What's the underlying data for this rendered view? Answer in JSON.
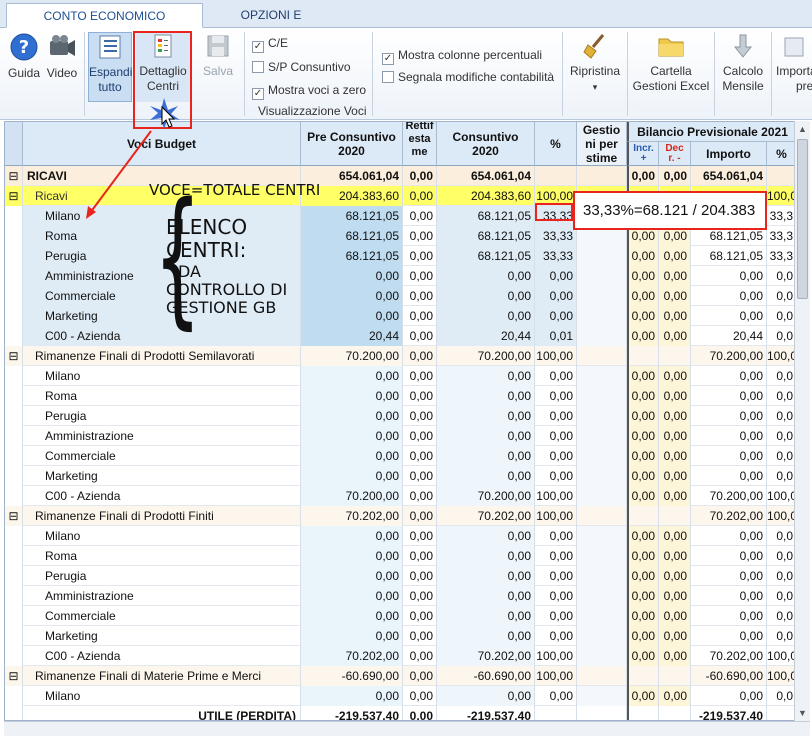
{
  "tabs": [
    {
      "label": "CONTO ECONOMICO ANNUALE",
      "active": true
    },
    {
      "label": "OPZIONI E STAMPA",
      "active": false
    }
  ],
  "ribbon": {
    "buttons": {
      "guida": "Guida",
      "video": "Video",
      "espandi": [
        "Espandi",
        "tutto"
      ],
      "dettaglio": [
        "Dettaglio",
        "Centri"
      ],
      "salva": "Salva",
      "ripristina": "Ripristina",
      "cartella": [
        "Cartella",
        "Gestioni Excel"
      ],
      "calcolo": [
        "Calcolo",
        "Mensile"
      ],
      "importa": [
        "Importa",
        "pre"
      ]
    },
    "checks": [
      {
        "label": "C/E",
        "checked": true
      },
      {
        "label": "S/P Consuntivo",
        "checked": false
      },
      {
        "label": "Mostra voci a zero",
        "checked": true
      },
      {
        "label": "Mostra colonne percentuali",
        "checked": true
      },
      {
        "label": "Segnala modifiche contabilità",
        "checked": false
      }
    ],
    "group_label": "Visualizzazione Voci"
  },
  "grid": {
    "headers": {
      "voci": "Voci Budget",
      "pre": [
        "Pre Consuntivo",
        "2020"
      ],
      "rett": [
        "Rettif",
        "esta",
        "me"
      ],
      "cons": [
        "Consuntivo",
        "2020"
      ],
      "pct": "%",
      "gest": [
        "Gestio",
        "ni per",
        "stime"
      ],
      "bil": "Bilancio Previsionale 2021",
      "incr": [
        "Incr.",
        "+"
      ],
      "decr": [
        "Dec",
        "r. -"
      ],
      "importo": "Importo",
      "pct2": "%"
    },
    "rows": [
      {
        "level": 0,
        "exp": "⊟",
        "label": "RICAVI",
        "pre": "654.061,04",
        "ret": "0,00",
        "cons": "654.061,04",
        "pct": "",
        "inc": "0,00",
        "dec": "0,00",
        "imp": "654.061,04",
        "pct2": ""
      },
      {
        "level": 1,
        "exp": "⊟",
        "label": "Ricavi",
        "pre": "204.383,60",
        "ret": "0,00",
        "cons": "204.383,60",
        "pct": "100,00",
        "inc": "",
        "dec": "",
        "imp": "204.383,60",
        "pct2": "100,0"
      },
      {
        "level": 2,
        "exp": "",
        "label": "Milano",
        "pre": "68.121,05",
        "ret": "0,00",
        "cons": "68.121,05",
        "pct": "33,33",
        "inc": "0,00",
        "dec": "0,00",
        "imp": "68.121,05",
        "pct2": "33,3"
      },
      {
        "level": 2,
        "exp": "",
        "label": "Roma",
        "pre": "68.121,05",
        "ret": "0,00",
        "cons": "68.121,05",
        "pct": "33,33",
        "inc": "0,00",
        "dec": "0,00",
        "imp": "68.121,05",
        "pct2": "33,3"
      },
      {
        "level": 2,
        "exp": "",
        "label": "Perugia",
        "pre": "68.121,05",
        "ret": "0,00",
        "cons": "68.121,05",
        "pct": "33,33",
        "inc": "0,00",
        "dec": "0,00",
        "imp": "68.121,05",
        "pct2": "33,3"
      },
      {
        "level": 2,
        "exp": "",
        "label": "Amministrazione",
        "pre": "0,00",
        "ret": "0,00",
        "cons": "0,00",
        "pct": "0,00",
        "inc": "0,00",
        "dec": "0,00",
        "imp": "0,00",
        "pct2": "0,0"
      },
      {
        "level": 2,
        "exp": "",
        "label": "Commerciale",
        "pre": "0,00",
        "ret": "0,00",
        "cons": "0,00",
        "pct": "0,00",
        "inc": "0,00",
        "dec": "0,00",
        "imp": "0,00",
        "pct2": "0,0"
      },
      {
        "level": 2,
        "exp": "",
        "label": "Marketing",
        "pre": "0,00",
        "ret": "0,00",
        "cons": "0,00",
        "pct": "0,00",
        "inc": "0,00",
        "dec": "0,00",
        "imp": "0,00",
        "pct2": "0,0"
      },
      {
        "level": 2,
        "exp": "",
        "label": "C00 - Azienda",
        "pre": "20,44",
        "ret": "0,00",
        "cons": "20,44",
        "pct": "0,01",
        "inc": "0,00",
        "dec": "0,00",
        "imp": "20,44",
        "pct2": "0,0"
      },
      {
        "level": 1,
        "exp": "⊟",
        "label": "Rimanenze Finali di Prodotti Semilavorati",
        "pre": "70.200,00",
        "ret": "0,00",
        "cons": "70.200,00",
        "pct": "100,00",
        "inc": "",
        "dec": "",
        "imp": "70.200,00",
        "pct2": "100,0"
      },
      {
        "level": 2,
        "exp": "",
        "label": "Milano",
        "pre": "0,00",
        "ret": "0,00",
        "cons": "0,00",
        "pct": "0,00",
        "inc": "0,00",
        "dec": "0,00",
        "imp": "0,00",
        "pct2": "0,0"
      },
      {
        "level": 2,
        "exp": "",
        "label": "Roma",
        "pre": "0,00",
        "ret": "0,00",
        "cons": "0,00",
        "pct": "0,00",
        "inc": "0,00",
        "dec": "0,00",
        "imp": "0,00",
        "pct2": "0,0"
      },
      {
        "level": 2,
        "exp": "",
        "label": "Perugia",
        "pre": "0,00",
        "ret": "0,00",
        "cons": "0,00",
        "pct": "0,00",
        "inc": "0,00",
        "dec": "0,00",
        "imp": "0,00",
        "pct2": "0,0"
      },
      {
        "level": 2,
        "exp": "",
        "label": "Amministrazione",
        "pre": "0,00",
        "ret": "0,00",
        "cons": "0,00",
        "pct": "0,00",
        "inc": "0,00",
        "dec": "0,00",
        "imp": "0,00",
        "pct2": "0,0"
      },
      {
        "level": 2,
        "exp": "",
        "label": "Commerciale",
        "pre": "0,00",
        "ret": "0,00",
        "cons": "0,00",
        "pct": "0,00",
        "inc": "0,00",
        "dec": "0,00",
        "imp": "0,00",
        "pct2": "0,0"
      },
      {
        "level": 2,
        "exp": "",
        "label": "Marketing",
        "pre": "0,00",
        "ret": "0,00",
        "cons": "0,00",
        "pct": "0,00",
        "inc": "0,00",
        "dec": "0,00",
        "imp": "0,00",
        "pct2": "0,0"
      },
      {
        "level": 2,
        "exp": "",
        "label": "C00 - Azienda",
        "pre": "70.200,00",
        "ret": "0,00",
        "cons": "70.200,00",
        "pct": "100,00",
        "inc": "0,00",
        "dec": "0,00",
        "imp": "70.200,00",
        "pct2": "100,0"
      },
      {
        "level": 1,
        "exp": "⊟",
        "label": "Rimanenze Finali di Prodotti Finiti",
        "pre": "70.202,00",
        "ret": "0,00",
        "cons": "70.202,00",
        "pct": "100,00",
        "inc": "",
        "dec": "",
        "imp": "70.202,00",
        "pct2": "100,0"
      },
      {
        "level": 2,
        "exp": "",
        "label": "Milano",
        "pre": "0,00",
        "ret": "0,00",
        "cons": "0,00",
        "pct": "0,00",
        "inc": "0,00",
        "dec": "0,00",
        "imp": "0,00",
        "pct2": "0,0"
      },
      {
        "level": 2,
        "exp": "",
        "label": "Roma",
        "pre": "0,00",
        "ret": "0,00",
        "cons": "0,00",
        "pct": "0,00",
        "inc": "0,00",
        "dec": "0,00",
        "imp": "0,00",
        "pct2": "0,0"
      },
      {
        "level": 2,
        "exp": "",
        "label": "Perugia",
        "pre": "0,00",
        "ret": "0,00",
        "cons": "0,00",
        "pct": "0,00",
        "inc": "0,00",
        "dec": "0,00",
        "imp": "0,00",
        "pct2": "0,0"
      },
      {
        "level": 2,
        "exp": "",
        "label": "Amministrazione",
        "pre": "0,00",
        "ret": "0,00",
        "cons": "0,00",
        "pct": "0,00",
        "inc": "0,00",
        "dec": "0,00",
        "imp": "0,00",
        "pct2": "0,0"
      },
      {
        "level": 2,
        "exp": "",
        "label": "Commerciale",
        "pre": "0,00",
        "ret": "0,00",
        "cons": "0,00",
        "pct": "0,00",
        "inc": "0,00",
        "dec": "0,00",
        "imp": "0,00",
        "pct2": "0,0"
      },
      {
        "level": 2,
        "exp": "",
        "label": "Marketing",
        "pre": "0,00",
        "ret": "0,00",
        "cons": "0,00",
        "pct": "0,00",
        "inc": "0,00",
        "dec": "0,00",
        "imp": "0,00",
        "pct2": "0,0"
      },
      {
        "level": 2,
        "exp": "",
        "label": "C00 - Azienda",
        "pre": "70.202,00",
        "ret": "0,00",
        "cons": "70.202,00",
        "pct": "100,00",
        "inc": "0,00",
        "dec": "0,00",
        "imp": "70.202,00",
        "pct2": "100,0"
      },
      {
        "level": 1,
        "exp": "⊟",
        "label": "Rimanenze Finali di Materie Prime e Merci",
        "pre": "-60.690,00",
        "ret": "0,00",
        "cons": "-60.690,00",
        "pct": "100,00",
        "inc": "",
        "dec": "",
        "imp": "-60.690,00",
        "pct2": "100,0"
      },
      {
        "level": 2,
        "exp": "",
        "label": "Milano",
        "pre": "0,00",
        "ret": "0,00",
        "cons": "0,00",
        "pct": "0,00",
        "inc": "0,00",
        "dec": "0,00",
        "imp": "0,00",
        "pct2": "0,0"
      },
      {
        "level": 9,
        "exp": "",
        "label": "UTILE (PERDITA)",
        "pre": "-219.537,40",
        "ret": "0,00",
        "cons": "-219.537,40",
        "pct": "",
        "inc": "",
        "dec": "",
        "imp": "-219.537,40",
        "pct2": ""
      }
    ]
  },
  "annotations": {
    "voce": "VOCE=TOTALE CENTRI",
    "elenco": [
      "ELENCO",
      "CENTRI:",
      "DA",
      "CONTROLLO DI",
      "GESTIONE GB"
    ],
    "callout": "33,33%=68.121 / 204.383"
  },
  "colors": {
    "ricavi_row": "#ffff66",
    "top_row": "#fbeedd",
    "sub_total": "#fdf6ec",
    "pre_col": "#bfdcf0",
    "highlight": "#e8241c",
    "bil_col": "#fdf5d8"
  }
}
